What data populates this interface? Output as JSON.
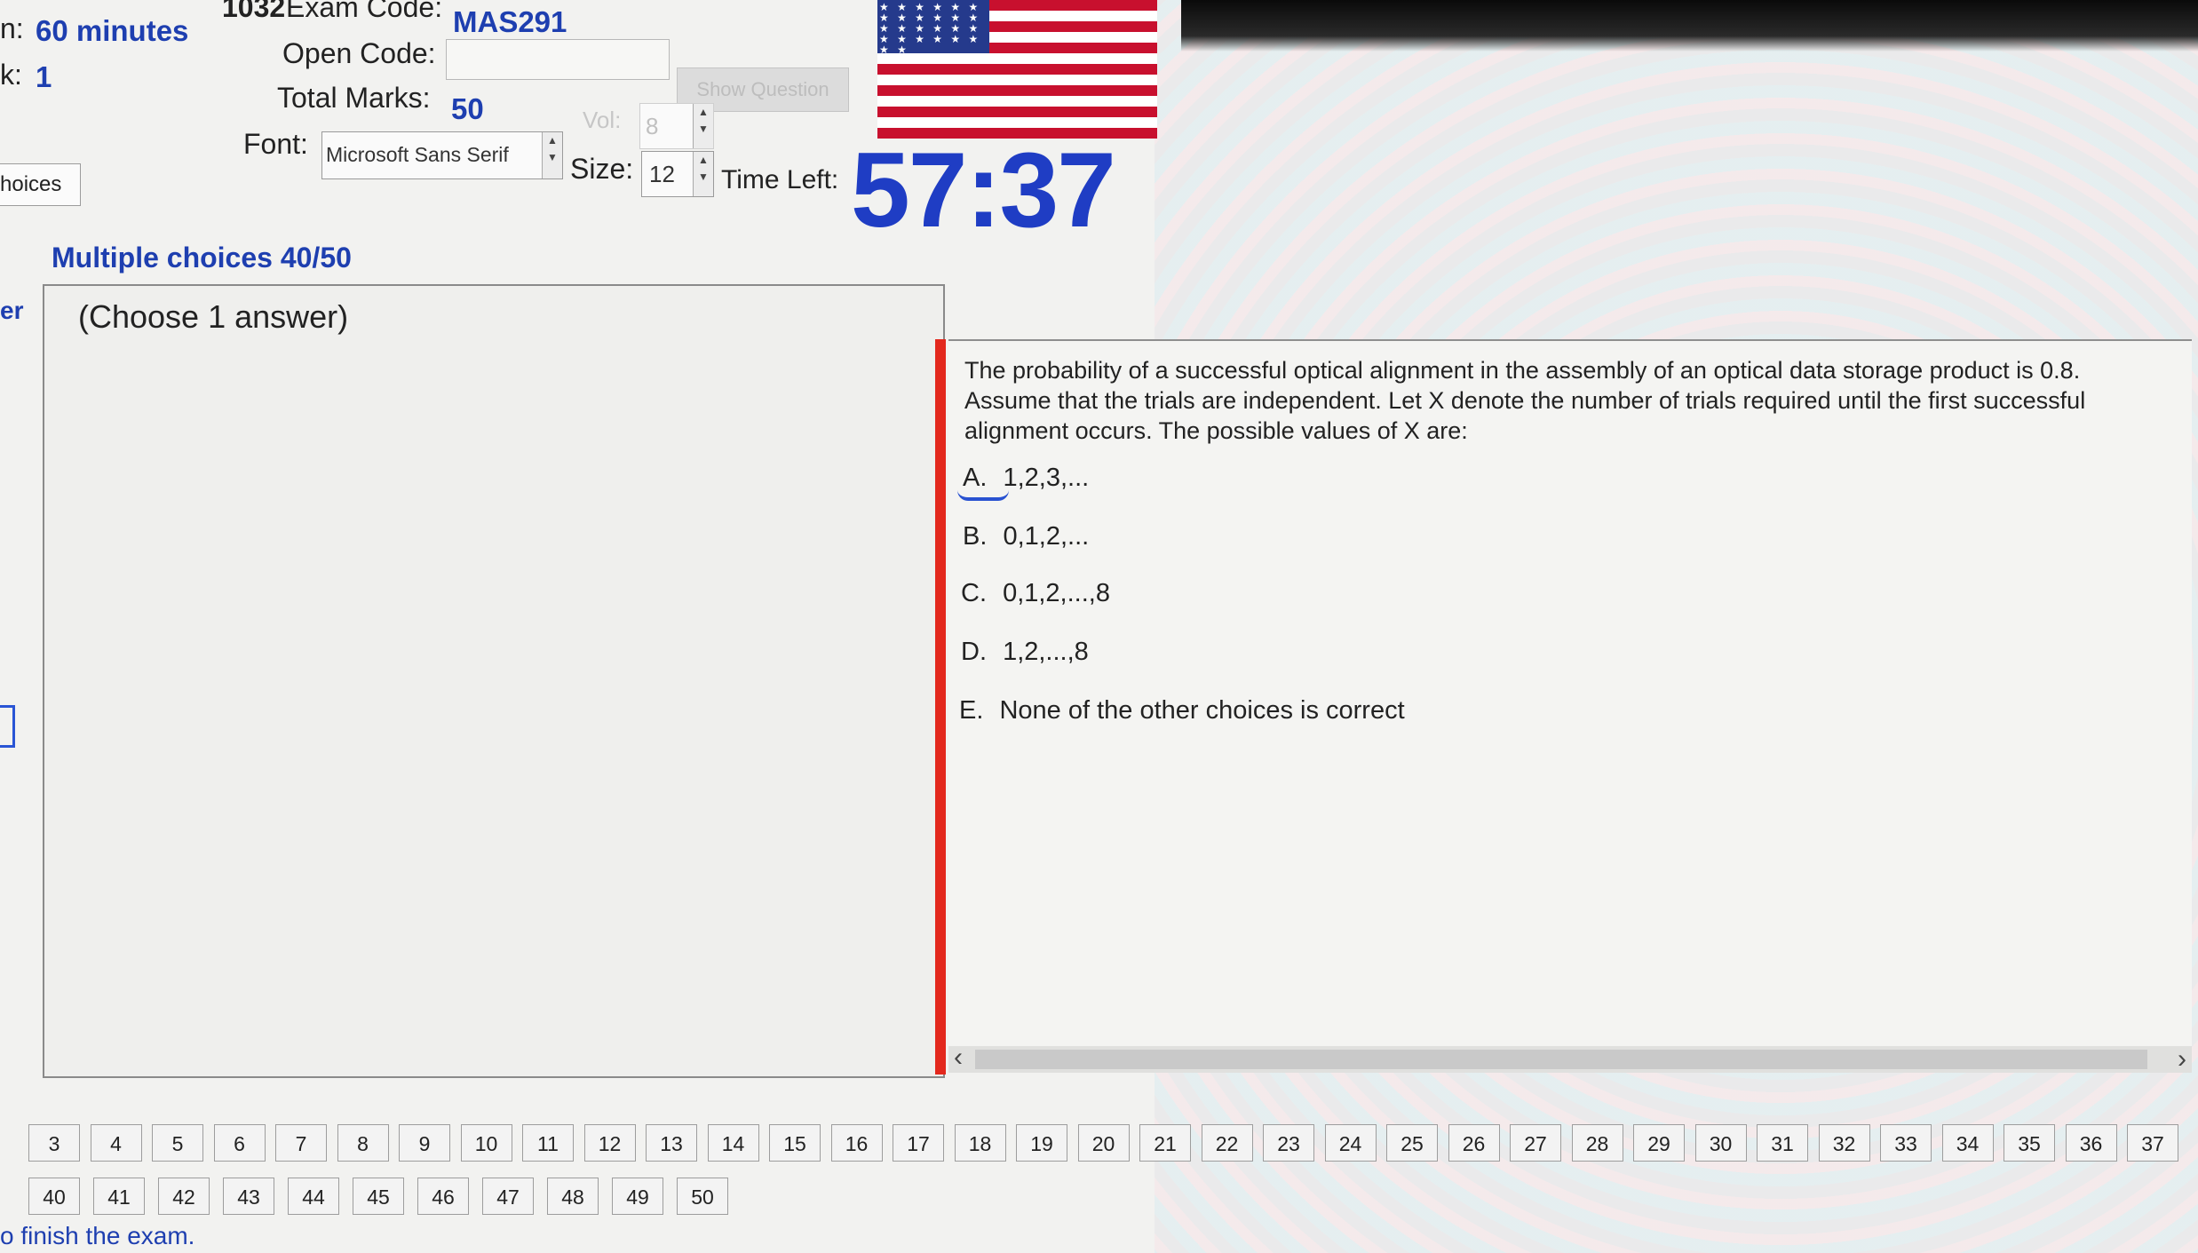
{
  "header": {
    "duration_label": "n:",
    "duration_value": "60 minutes",
    "block_label": "k:",
    "block_value": "1",
    "exam_code_prefix": "1032",
    "exam_code_label": "Exam Code:",
    "exam_code_value": "MAS291",
    "open_code_label": "Open Code:",
    "open_code_value": "",
    "show_question_label": "Show Question",
    "total_marks_label": "Total Marks:",
    "total_marks_value": "50",
    "vol_label": "Vol:",
    "vol_value": "8",
    "font_label": "Font:",
    "font_value": "Microsoft Sans Serif",
    "size_label": "Size:",
    "size_value": "12",
    "time_left_label": "Time Left:",
    "time_left_value": "57:37",
    "tab_label": "hoices"
  },
  "section": {
    "title": "Multiple choices 40/50",
    "side_label": "er",
    "choose_hint": "(Choose 1 answer)"
  },
  "question": {
    "line1": "The probability of a successful optical alignment in the assembly of an optical data storage product is 0.8.",
    "line2": "Assume that the trials are independent. Let X denote the number of trials required until the first successful",
    "line3": "alignment occurs. The possible values of X are:",
    "choices": [
      {
        "letter": "A.",
        "text": "1,2,3,..."
      },
      {
        "letter": "B.",
        "text": "0,1,2,..."
      },
      {
        "letter": "C.",
        "text": "0,1,2,...,8"
      },
      {
        "letter": "D.",
        "text": "1,2,...,8"
      },
      {
        "letter": "E.",
        "text": "None of the other choices is correct"
      }
    ]
  },
  "scroll": {
    "left_arrow": "‹",
    "right_arrow": "›"
  },
  "navigation": {
    "row1": [
      "3",
      "4",
      "5",
      "6",
      "7",
      "8",
      "9",
      "10",
      "11",
      "12",
      "13",
      "14",
      "15",
      "16",
      "17",
      "18",
      "19",
      "20",
      "21",
      "22",
      "23",
      "24",
      "25",
      "26",
      "27",
      "28",
      "29",
      "30",
      "31",
      "32",
      "33",
      "34",
      "35",
      "36",
      "37"
    ],
    "row2": [
      "40",
      "41",
      "42",
      "43",
      "44",
      "45",
      "46",
      "47",
      "48",
      "49",
      "50"
    ]
  },
  "footer": {
    "finish_text": "o finish the exam."
  },
  "colors": {
    "accent_blue": "#1e3fb0",
    "timer_blue": "#1f3dc4",
    "selection_red": "#e3281d"
  }
}
